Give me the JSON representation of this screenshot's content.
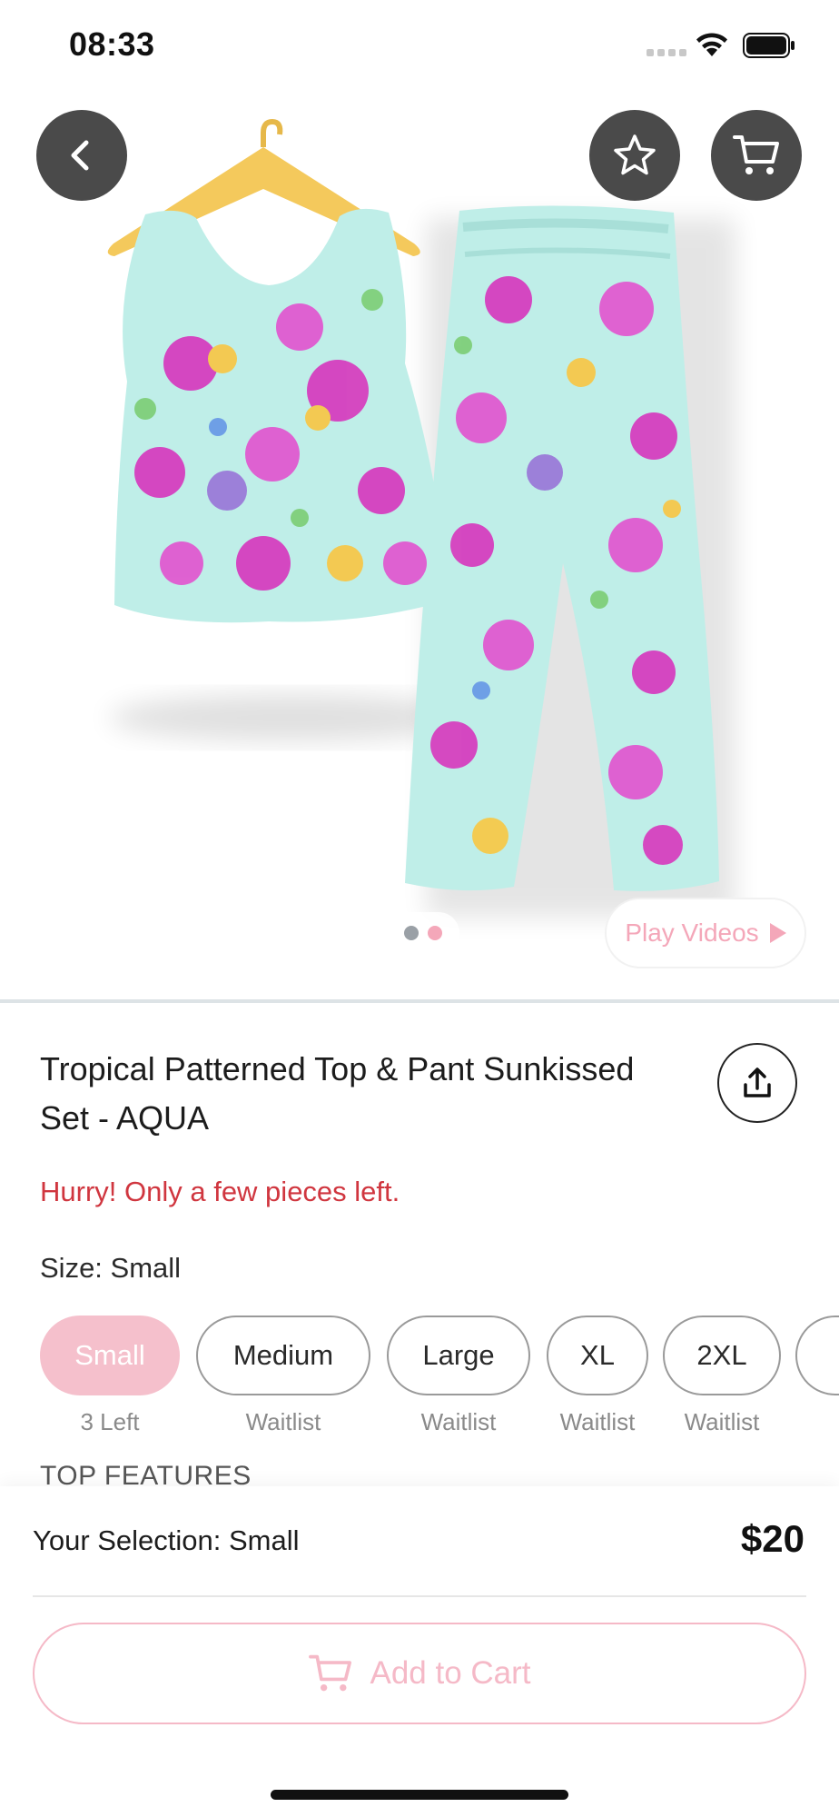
{
  "status_bar": {
    "time": "08:33",
    "icons": [
      "signal-icon",
      "wifi-icon",
      "battery-icon"
    ]
  },
  "hero": {
    "buttons": {
      "back": "chevron-left-icon",
      "favorite": "star-icon",
      "cart": "cart-icon"
    },
    "pager": {
      "total": 2,
      "active_index": 1
    },
    "play_videos_label": "Play Videos"
  },
  "product": {
    "title": "Tropical Patterned Top & Pant Sunkissed Set - AQUA",
    "stock_message": "Hurry! Only a few pieces left.",
    "size_label": "Size: Small",
    "sizes": [
      {
        "label": "Small",
        "note": "3 Left",
        "selected": true
      },
      {
        "label": "Medium",
        "note": "Waitlist",
        "selected": false
      },
      {
        "label": "Large",
        "note": "Waitlist",
        "selected": false
      },
      {
        "label": "XL",
        "note": "Waitlist",
        "selected": false
      },
      {
        "label": "2XL",
        "note": "Waitlist",
        "selected": false
      }
    ],
    "section_heading": "TOP FEATURES"
  },
  "bottom_sheet": {
    "selection_text": "Your Selection: Small",
    "price": "$20",
    "add_to_cart_label": "Add to Cart"
  },
  "colors": {
    "accent_pink": "#f5c0cc",
    "alert_red": "#d0363f",
    "dark_button": "#4a4a4a",
    "aqua_fabric": "#bfeee8",
    "magenta_flower": "#d63fbf",
    "yellow_flower": "#f6c84a"
  }
}
